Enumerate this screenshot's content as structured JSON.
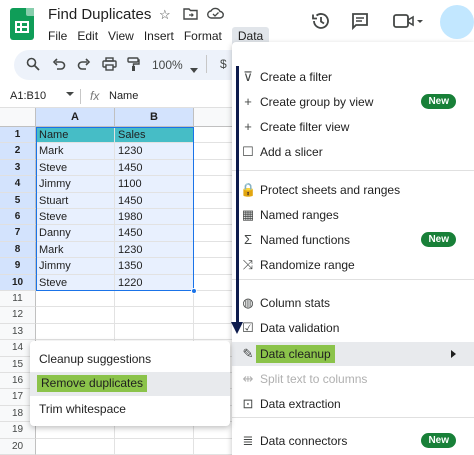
{
  "app": {
    "title": "Find Duplicates",
    "menus": [
      "File",
      "Edit",
      "View",
      "Insert",
      "Format",
      "Data"
    ],
    "active_menu": "Data"
  },
  "toolbar": {
    "zoom": "100%",
    "currency": "$"
  },
  "formula_bar": {
    "name_box": "A1:B10",
    "fx": "fx",
    "value": "Name"
  },
  "sheet": {
    "columns": [
      "A",
      "B"
    ],
    "rows": [
      "1",
      "2",
      "3",
      "4",
      "5",
      "6",
      "7",
      "8",
      "9",
      "10",
      "11",
      "12",
      "13",
      "14",
      "15",
      "16",
      "17",
      "18",
      "19",
      "20"
    ],
    "cells": [
      [
        "Name",
        "Sales"
      ],
      [
        "Mark",
        "1230"
      ],
      [
        "Steve",
        "1450"
      ],
      [
        "Jimmy",
        "1100"
      ],
      [
        "Stuart",
        "1450"
      ],
      [
        "Steve",
        "1980"
      ],
      [
        "Danny",
        "1450"
      ],
      [
        "Mark",
        "1230"
      ],
      [
        "Jimmy",
        "1350"
      ],
      [
        "Steve",
        "1220"
      ]
    ],
    "colors": {
      "header_fill": "#46bdc6",
      "selection_fill": "#e8f0fe",
      "selection_border": "#1a73e8"
    }
  },
  "data_menu": {
    "items": [
      {
        "icon": "filter-icon",
        "glyph": "⊽",
        "label": "Create a filter"
      },
      {
        "icon": "plus-icon",
        "glyph": "+",
        "label": "Create group by view",
        "badge": "New"
      },
      {
        "icon": "plus-icon",
        "glyph": "+",
        "label": "Create filter view"
      },
      {
        "icon": "slicer-icon",
        "glyph": "☐",
        "label": "Add a slicer"
      },
      {
        "icon": "lock-icon",
        "glyph": "🔒",
        "label": "Protect sheets and ranges"
      },
      {
        "icon": "named-ranges-icon",
        "glyph": "▦",
        "label": "Named ranges"
      },
      {
        "icon": "sigma-icon",
        "glyph": "Σ",
        "label": "Named functions",
        "badge": "New"
      },
      {
        "icon": "shuffle-icon",
        "glyph": "⤨",
        "label": "Randomize range"
      },
      {
        "icon": "lightbulb-icon",
        "glyph": "◍",
        "label": "Column stats"
      },
      {
        "icon": "validation-icon",
        "glyph": "☑",
        "label": "Data validation"
      },
      {
        "icon": "magic-wand-icon",
        "glyph": "✎",
        "label": "Data cleanup"
      },
      {
        "icon": "split-icon",
        "glyph": "⇹",
        "label": "Split text to columns"
      },
      {
        "icon": "extraction-icon",
        "glyph": "⊡",
        "label": "Data extraction"
      },
      {
        "icon": "database-icon",
        "glyph": "≣",
        "label": "Data connectors",
        "badge": "New"
      }
    ],
    "highlight_color": "#8bc34a",
    "badge_color": "#188038"
  },
  "cleanup_submenu": {
    "items": [
      {
        "label": "Cleanup suggestions"
      },
      {
        "label": "Remove duplicates"
      },
      {
        "label": "Trim whitespace"
      }
    ]
  },
  "annotation": {
    "arrow_color": "#0d1b4c"
  }
}
